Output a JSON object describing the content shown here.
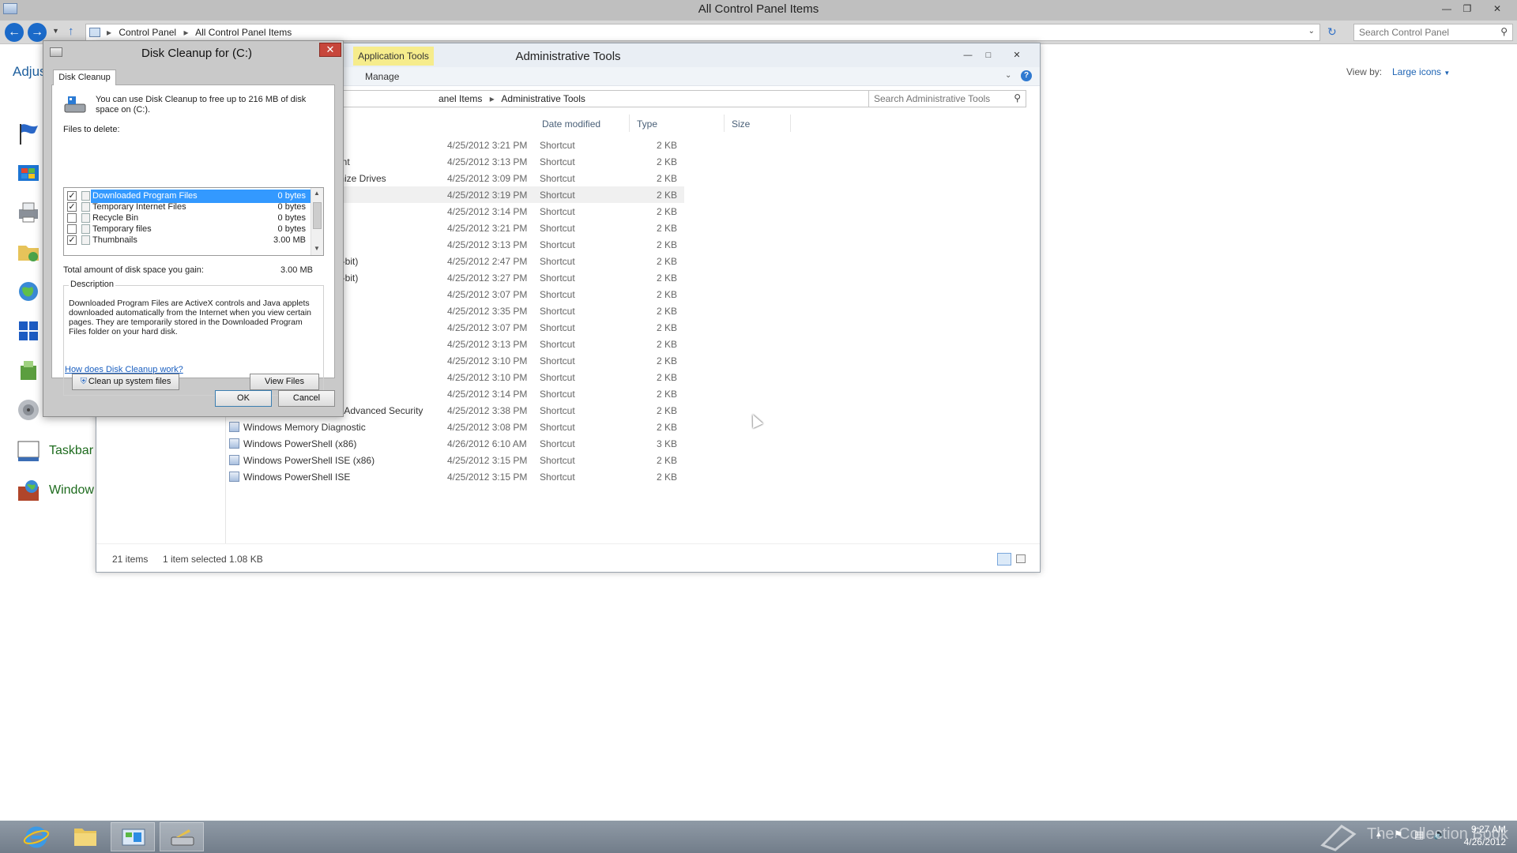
{
  "control_panel": {
    "title": "All Control Panel Items",
    "breadcrumbs": [
      "Control Panel",
      "All Control Panel Items"
    ],
    "search_placeholder": "Search Control Panel",
    "heading_partial": "Adjus",
    "view_by_label": "View by:",
    "view_by_value": "Large icons",
    "items_partial": [
      {
        "icon": "action-center-flag-icon",
        "label": ""
      },
      {
        "icon": "windows-update-icon",
        "label": ""
      },
      {
        "icon": "devices-printers-icon",
        "label": ""
      },
      {
        "icon": "folder-options-icon",
        "label": ""
      },
      {
        "icon": "internet-options-icon",
        "label": ""
      },
      {
        "icon": "region-icon",
        "label": ""
      },
      {
        "icon": "recovery-icon",
        "label": ""
      },
      {
        "icon": "sound-icon",
        "label": ""
      },
      {
        "icon": "taskbar-icon",
        "label": "Taskbar"
      },
      {
        "icon": "windows-firewall-icon",
        "label": "Window"
      }
    ]
  },
  "admin_tools": {
    "title": "Administrative Tools",
    "context_tab": "Application Tools",
    "ribbon_tab": "Manage",
    "breadcrumbs": [
      "anel Items",
      "Administrative Tools"
    ],
    "search_placeholder": "Search Administrative Tools",
    "columns": {
      "date": "Date modified",
      "type": "Type",
      "size": "Size"
    },
    "rows": [
      {
        "name": "",
        "date": "4/25/2012 3:21 PM",
        "type": "Shortcut",
        "size": "2 KB"
      },
      {
        "name": "ent",
        "date": "4/25/2012 3:13 PM",
        "type": "Shortcut",
        "size": "2 KB"
      },
      {
        "name": "mize Drives",
        "date": "4/25/2012 3:09 PM",
        "type": "Shortcut",
        "size": "2 KB"
      },
      {
        "name": "",
        "date": "4/25/2012 3:19 PM",
        "type": "Shortcut",
        "size": "2 KB"
      },
      {
        "name": "",
        "date": "4/25/2012 3:14 PM",
        "type": "Shortcut",
        "size": "2 KB"
      },
      {
        "name": "",
        "date": "4/25/2012 3:21 PM",
        "type": "Shortcut",
        "size": "2 KB"
      },
      {
        "name": "",
        "date": "4/25/2012 3:13 PM",
        "type": "Shortcut",
        "size": "2 KB"
      },
      {
        "name": "2-bit)",
        "date": "4/25/2012 2:47 PM",
        "type": "Shortcut",
        "size": "2 KB"
      },
      {
        "name": "4-bit)",
        "date": "4/25/2012 3:27 PM",
        "type": "Shortcut",
        "size": "2 KB"
      },
      {
        "name": "",
        "date": "4/25/2012 3:07 PM",
        "type": "Shortcut",
        "size": "2 KB"
      },
      {
        "name": "",
        "date": "4/25/2012 3:35 PM",
        "type": "Shortcut",
        "size": "2 KB"
      },
      {
        "name": "",
        "date": "4/25/2012 3:07 PM",
        "type": "Shortcut",
        "size": "2 KB"
      },
      {
        "name": "",
        "date": "4/25/2012 3:13 PM",
        "type": "Shortcut",
        "size": "2 KB"
      },
      {
        "name": "",
        "date": "4/25/2012 3:10 PM",
        "type": "Shortcut",
        "size": "2 KB"
      },
      {
        "name": "",
        "date": "4/25/2012 3:10 PM",
        "type": "Shortcut",
        "size": "2 KB"
      },
      {
        "name": "",
        "date": "4/25/2012 3:14 PM",
        "type": "Shortcut",
        "size": "2 KB"
      },
      {
        "name": "h Advanced Security",
        "date": "4/25/2012 3:38 PM",
        "type": "Shortcut",
        "size": "2 KB"
      },
      {
        "name": "Windows Memory Diagnostic",
        "date": "4/25/2012 3:08 PM",
        "type": "Shortcut",
        "size": "2 KB"
      },
      {
        "name": "Windows PowerShell (x86)",
        "date": "4/26/2012 6:10 AM",
        "type": "Shortcut",
        "size": "3 KB"
      },
      {
        "name": "Windows PowerShell ISE (x86)",
        "date": "4/25/2012 3:15 PM",
        "type": "Shortcut",
        "size": "2 KB"
      },
      {
        "name": "Windows PowerShell ISE",
        "date": "4/25/2012 3:15 PM",
        "type": "Shortcut",
        "size": "2 KB"
      }
    ],
    "status": {
      "count": "21 items",
      "selection": "1 item selected",
      "size": "1.08 KB"
    }
  },
  "disk_cleanup": {
    "title": "Disk Cleanup for  (C:)",
    "tab": "Disk Cleanup",
    "intro_line1": "You can use Disk Cleanup to free up to 216 MB of disk",
    "intro_line2": "space on  (C:).",
    "files_label": "Files to delete:",
    "files": [
      {
        "checked": true,
        "label": "Downloaded Program Files",
        "value": "0 bytes",
        "selected": true
      },
      {
        "checked": true,
        "label": "Temporary Internet Files",
        "value": "0 bytes",
        "selected": false
      },
      {
        "checked": false,
        "label": "Recycle Bin",
        "value": "0 bytes",
        "selected": false
      },
      {
        "checked": false,
        "label": "Temporary files",
        "value": "0 bytes",
        "selected": false
      },
      {
        "checked": true,
        "label": "Thumbnails",
        "value": "3.00 MB",
        "selected": false
      }
    ],
    "total_label": "Total amount of disk space you gain:",
    "total_value": "3.00 MB",
    "description_label": "Description",
    "description_lines": [
      "Downloaded Program Files are ActiveX controls and Java applets",
      "downloaded automatically from the Internet when you view certain",
      "pages. They are temporarily stored in the Downloaded Program",
      "Files folder on your hard disk."
    ],
    "cleanup_button": "Clean up system files",
    "view_files_button": "View Files",
    "help_link": "How does Disk Cleanup work?",
    "ok_button": "OK",
    "cancel_button": "Cancel"
  },
  "taskbar": {
    "time": "9:27 AM",
    "date": "4/26/2012",
    "watermark": "The Collection Book"
  }
}
